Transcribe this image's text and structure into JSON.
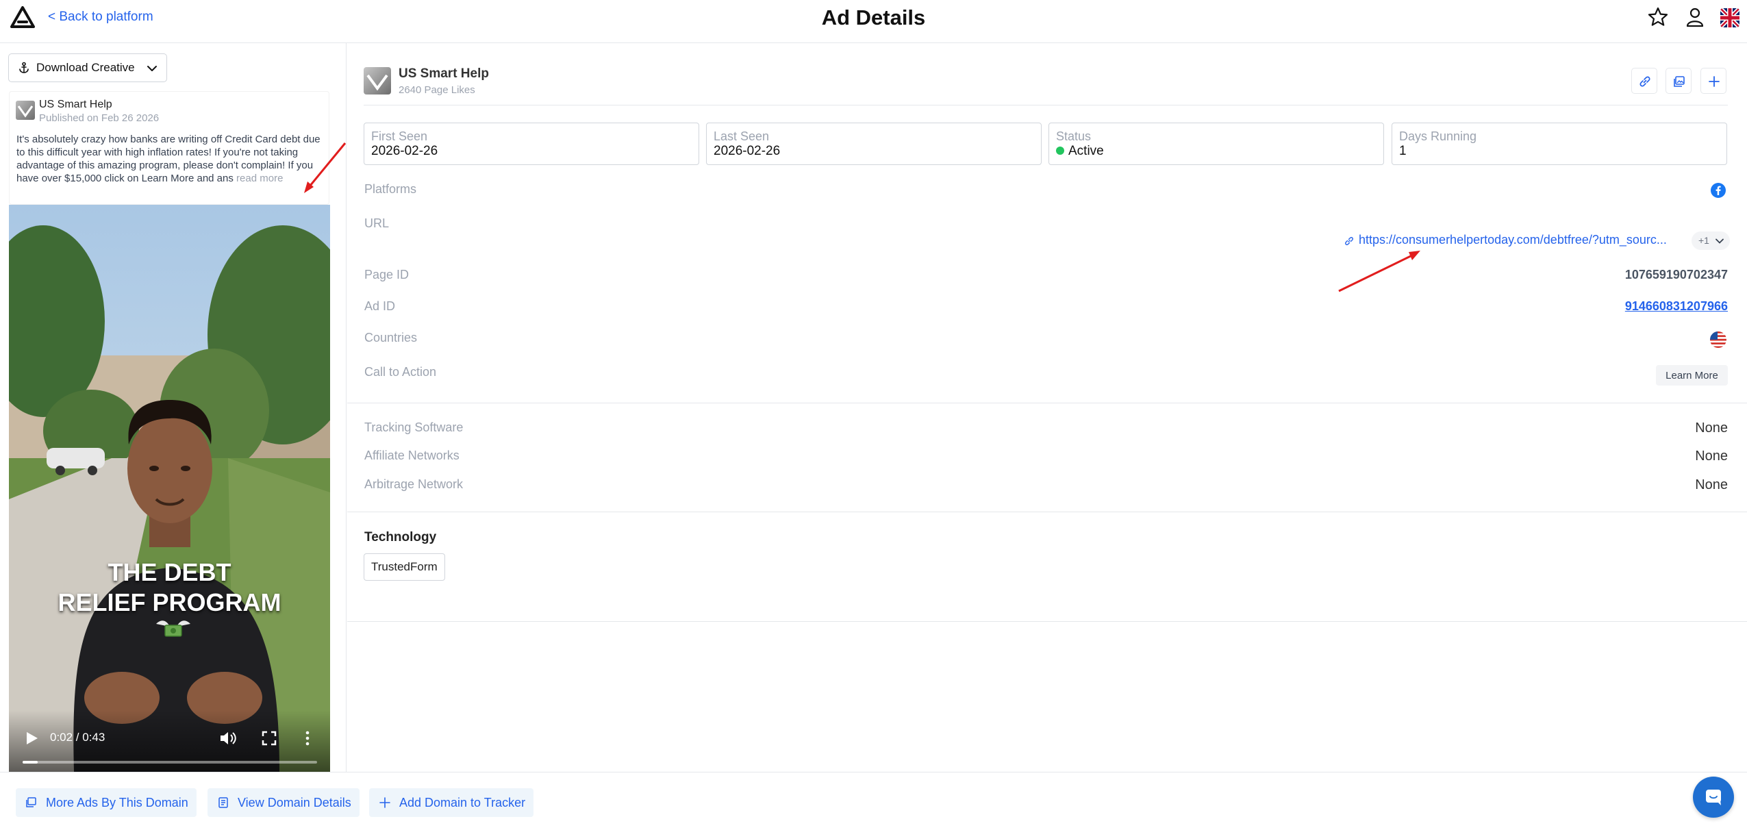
{
  "header": {
    "back_label": "< Back to platform",
    "title": "Ad Details",
    "icons": [
      "logo-icon",
      "star-icon",
      "user-icon",
      "uk-flag-icon"
    ]
  },
  "left": {
    "download_label": "Download Creative",
    "post": {
      "name": "US Smart Help",
      "date": "Published on Feb 26 2026",
      "text": "It's absolutely crazy how banks are writing off Credit Card debt due to this difficult year with high inflation rates! If you're not taking advantage of this amazing program, please don't complain! If you have over $15,000 click on Learn More and ans ",
      "read_more": "read more"
    },
    "video": {
      "caption_line1": "THE DEBT",
      "caption_line2": "RELIEF PROGRAM",
      "time": "0:02 / 0:43",
      "progress": 0.05
    }
  },
  "advertiser": {
    "name": "US Smart Help",
    "likes": "2640 Page Likes"
  },
  "stats": {
    "first_seen_label": "First Seen",
    "first_seen": "2026-02-26",
    "last_seen_label": "Last Seen",
    "last_seen": "2026-02-26",
    "status_label": "Status",
    "status": "Active",
    "days_label": "Days Running",
    "days": "1"
  },
  "details": {
    "platforms_label": "Platforms",
    "url_label": "URL",
    "url": "https://consumerhelpertoday.com/debtfree/?utm_sourc...",
    "url_more": "+1",
    "page_id_label": "Page ID",
    "page_id": "107659190702347",
    "ad_id_label": "Ad ID",
    "ad_id": "914660831207966",
    "countries_label": "Countries",
    "cta_label": "Call to Action",
    "cta": "Learn More"
  },
  "tracking": {
    "software_label": "Tracking Software",
    "software": "None",
    "affiliate_label": "Affiliate Networks",
    "affiliate": "None",
    "arbitrage_label": "Arbitrage Network",
    "arbitrage": "None"
  },
  "technology": {
    "title": "Technology",
    "tag": "TrustedForm"
  },
  "footer": {
    "more_ads": "More Ads By This Domain",
    "domain_details": "View Domain Details",
    "add_tracker": "Add Domain to Tracker"
  },
  "colors": {
    "accent": "#2563eb",
    "status_active": "#22c55e",
    "annotation": "#e11d1d",
    "chat": "#1f6fd1"
  }
}
